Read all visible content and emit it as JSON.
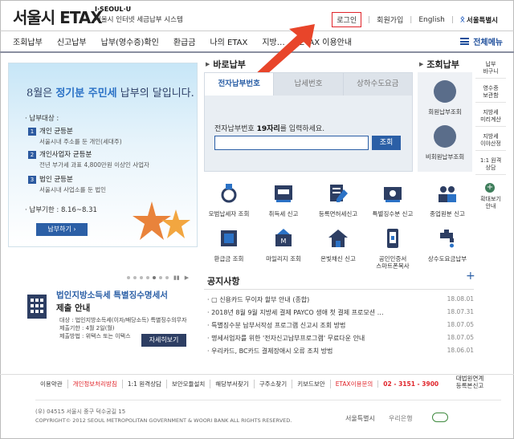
{
  "header": {
    "logo_main": "서울시 ETAX",
    "logo_sub1": "I·SEOUL·U",
    "logo_sub2": "서울시 인터넷 세금납부 시스템",
    "links": {
      "login": "로그인",
      "join": "회원가입",
      "english": "English",
      "city": "서울특별시"
    }
  },
  "nav": {
    "items": [
      "조회납부",
      "신고납부",
      "납부(영수증)확인",
      "환급금",
      "나의 ETAX",
      "지방…",
      "ETAX 이용안내"
    ],
    "all_menu": "전체메뉴"
  },
  "banner": {
    "title_prefix": "8월은",
    "title_highlight": "정기분 주민세",
    "title_suffix": "납부의 달입니다.",
    "target_label": "· 납부대상 :",
    "items": [
      {
        "num": "1",
        "title": "개인 균등분",
        "desc": "서울시내 주소를 둔 개인(세대주)"
      },
      {
        "num": "2",
        "title": "개인사업자 균등분",
        "desc": "전년 부가세 과표 4,800만원 이상인 사업자"
      },
      {
        "num": "3",
        "title": "법인 균등분",
        "desc": "서울시내 사업소를 둔 법인"
      }
    ],
    "deadline": "· 납부기한 : 8.16~8.31",
    "button": "납부하기 ›"
  },
  "corp_notice": {
    "title": "법인지방소득세 특별징수명세서",
    "title2": "제출 안내",
    "lines": [
      "대상 : 법인지방소득세(이자/배당소득) 특별징수의무자",
      "제출기한 : 4월 2일(월)",
      "제출방법 : 위택스 또는 이택스"
    ],
    "button": "자세히보기"
  },
  "payment": {
    "title": "바로납부",
    "tabs": [
      "전자납부번호",
      "납세번호",
      "상하수도요금"
    ],
    "label_prefix": "전자납부번호",
    "label_bold": "19자리",
    "label_suffix": "를 입력하세요.",
    "search": "조회"
  },
  "lookup": {
    "title": "조회납부",
    "member": "회원납부조회",
    "nonmember": "비회원납부조회"
  },
  "sidebar": {
    "items": [
      "납부\n바구니",
      "영수증\n보관함",
      "지방세\n미리계산",
      "지방세\n이야산정",
      "1:1 원격\n상담"
    ],
    "zoom": "확대보기\n안내"
  },
  "services": [
    {
      "label": "모범납세자 조회",
      "icon": "medal-icon"
    },
    {
      "label": "취득세 신고",
      "icon": "car-register-icon"
    },
    {
      "label": "등록면허세신고",
      "icon": "document-pen-icon"
    },
    {
      "label": "특별징수분 신고",
      "icon": "money-stack-icon"
    },
    {
      "label": "종업원분 신고",
      "icon": "employees-icon"
    },
    {
      "label": "환급금 조회",
      "icon": "refund-icon"
    },
    {
      "label": "마일리지 조회",
      "icon": "mileage-icon"
    },
    {
      "label": "온빛채신 신고",
      "icon": "house-icon"
    },
    {
      "label": "공인인증서\n스마트폰복사",
      "icon": "phone-lock-icon"
    },
    {
      "label": "상수도요금납부",
      "icon": "water-tap-icon"
    }
  ],
  "notices": {
    "title": "공지사항",
    "more": "+",
    "rows": [
      {
        "text": "· ▢ 신용카드 무이자 할부 안내 (종합)",
        "date": "18.08.01"
      },
      {
        "text": "· 2018년 8월 9월 지방세 결제 PAYCO 생애 첫 결제 프로모션 …",
        "date": "18.07.31"
      },
      {
        "text": "· 특별징수분 납부서작성 프로그램 신고시 조회 방법",
        "date": "18.07.05"
      },
      {
        "text": "· 명세서업자를 위한 '전자신고납부프로그램' 무료다운 안내",
        "date": "18.07.05"
      },
      {
        "text": "· 우리카드, BC카드 결제장애시 오류 조치 방법",
        "date": "18.06.01"
      }
    ]
  },
  "footer": {
    "links": [
      "이용약관",
      "개인정보처리방침",
      "1:1 원격상담",
      "보안모듈설치",
      "해당부서찾기",
      "구주소찾기",
      "키보드보안",
      "ETAX이용문의",
      "02 - 3151 - 3900"
    ],
    "right_link": "대법원연계\n등록본신고",
    "address": "(우) 04515  서울시 중구 덕수궁길 15",
    "copyright": "COPYRIGHT© 2012 SEOUL METROPOLITAN GOVERNMENT & WOORI BANK ALL RIGHTS RESERVED.",
    "logo_city": "서울특별시",
    "logo_bank": "우리은행"
  },
  "colors": {
    "accent": "#2b5fa6",
    "alert": "#e0242a",
    "nav_border": "#8a8fa0"
  }
}
